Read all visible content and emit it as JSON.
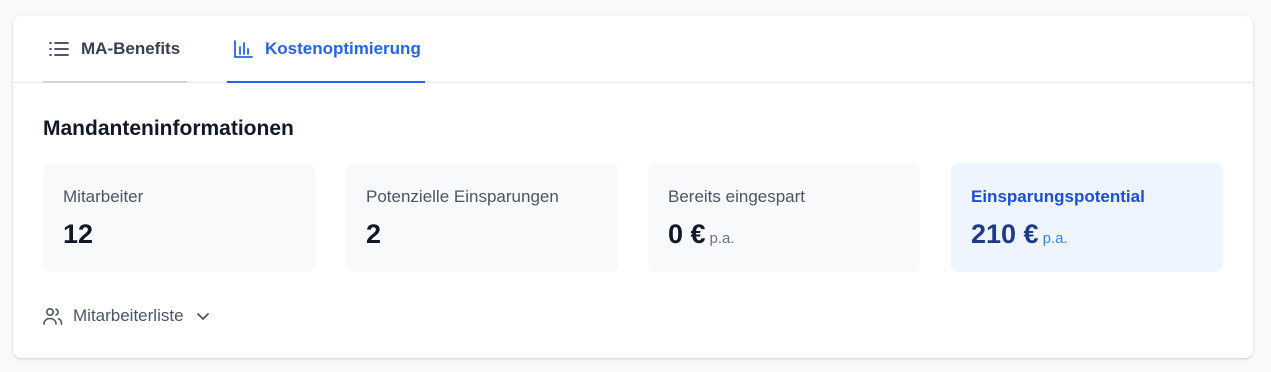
{
  "tabs": [
    {
      "label": "MA-Benefits",
      "icon": "list-icon"
    },
    {
      "label": "Kostenoptimierung",
      "icon": "bar-chart-icon",
      "active": true
    }
  ],
  "section": {
    "title": "Mandanteninformationen"
  },
  "stats": [
    {
      "label": "Mitarbeiter",
      "value": "12"
    },
    {
      "label": "Potenzielle Einsparungen",
      "value": "2"
    },
    {
      "label": "Bereits eingespart",
      "value": "0 €",
      "suffix": "p.a."
    },
    {
      "label": "Einsparungspotential",
      "value": "210 €",
      "suffix": "p.a."
    }
  ],
  "employee_list": {
    "label": "Mitarbeiterliste",
    "icon": "users-icon"
  },
  "colors": {
    "accent": "#2563eb",
    "highlight_bg": "#eef5fe"
  }
}
